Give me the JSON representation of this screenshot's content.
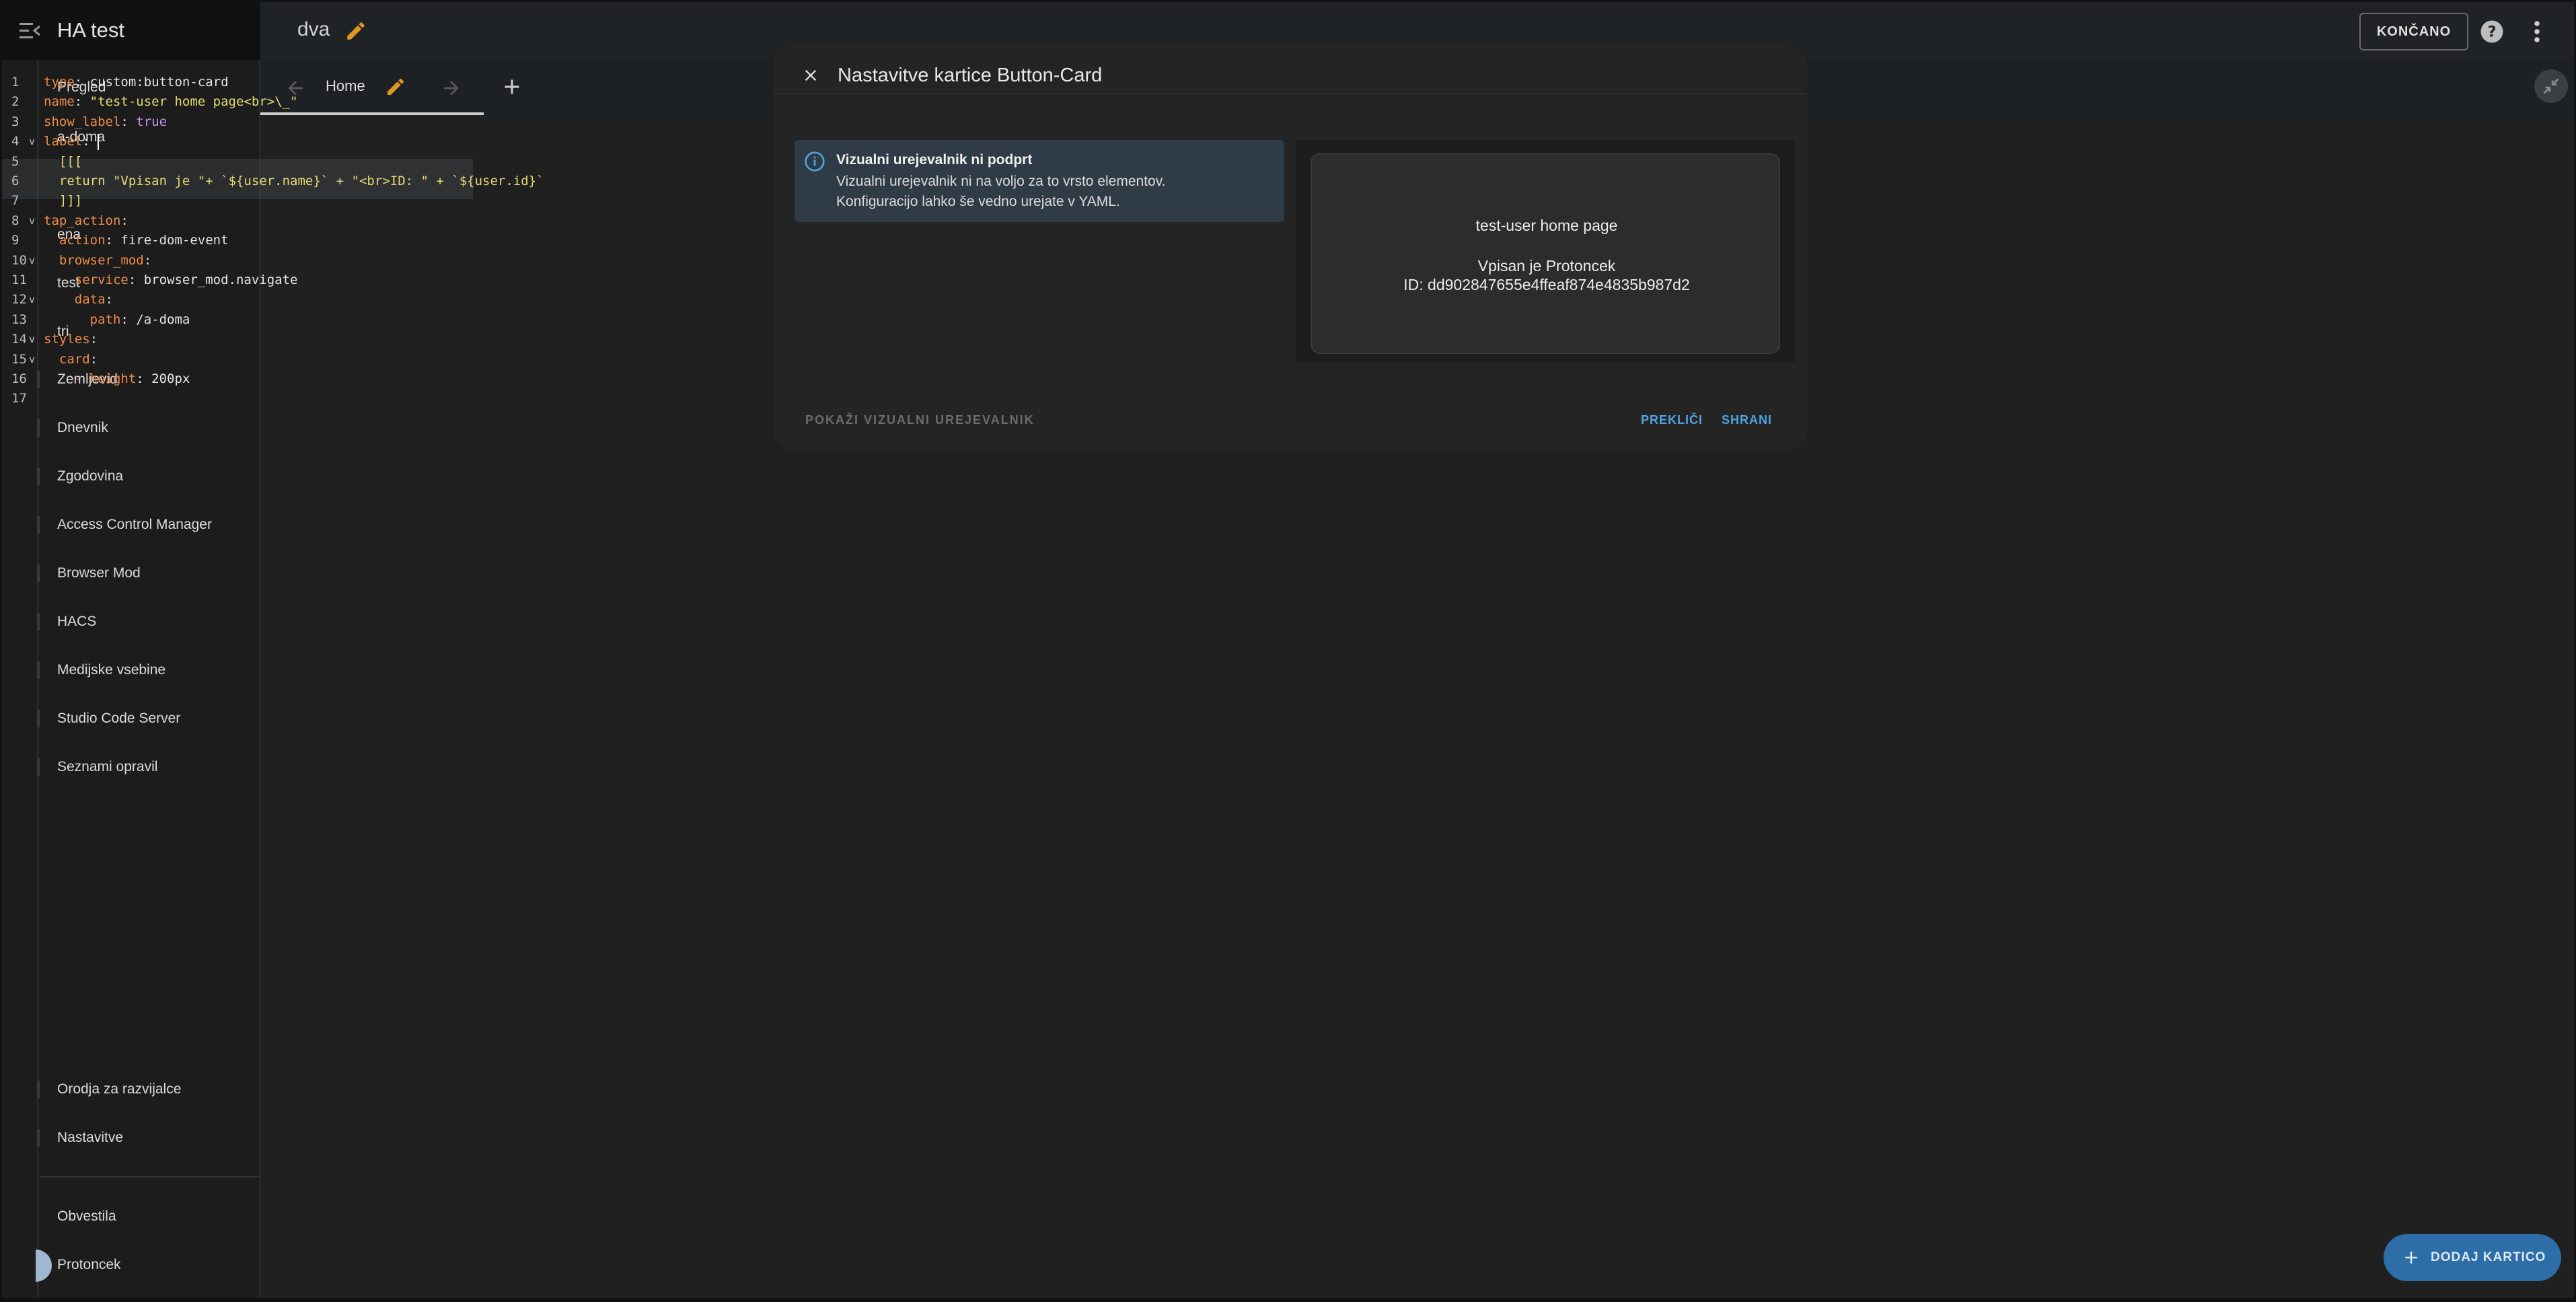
{
  "sidebar": {
    "title": "HA test",
    "items": [
      {
        "label": "Pregled"
      },
      {
        "label": "a-doma"
      },
      {
        "label": "ena"
      },
      {
        "label": "test"
      },
      {
        "label": "tri"
      },
      {
        "label": "Zemljevid"
      },
      {
        "label": "Dnevnik"
      },
      {
        "label": "Zgodovina"
      },
      {
        "label": "Access Control Manager"
      },
      {
        "label": "Browser Mod"
      },
      {
        "label": "HACS"
      },
      {
        "label": "Medijske vsebine"
      },
      {
        "label": "Studio Code Server"
      },
      {
        "label": "Seznami opravil"
      }
    ],
    "bottom_items": [
      {
        "label": "Orodja za razvijalce"
      },
      {
        "label": "Nastavitve"
      }
    ],
    "notifications_label": "Obvestila",
    "user_label": "Protoncek"
  },
  "topbar": {
    "view_title": "dva",
    "done_label": "KONČANO"
  },
  "tabbar": {
    "home_label": "Home"
  },
  "code": {
    "lines": [
      {
        "n": "1",
        "fold": "",
        "parts": [
          [
            "k",
            "type"
          ],
          [
            "p",
            ": custom:button-card"
          ]
        ]
      },
      {
        "n": "2",
        "fold": "",
        "parts": [
          [
            "k",
            "name"
          ],
          [
            "p",
            ": "
          ],
          [
            "s",
            "\"test-user home page<br>\\_\""
          ]
        ]
      },
      {
        "n": "3",
        "fold": "",
        "parts": [
          [
            "k",
            "show_label"
          ],
          [
            "p",
            ": "
          ],
          [
            "v",
            "true"
          ]
        ]
      },
      {
        "n": "4",
        "fold": "v",
        "parts": [
          [
            "k",
            "label"
          ],
          [
            "p",
            ": "
          ]
        ]
      },
      {
        "n": "5",
        "fold": "",
        "parts": [
          [
            "s",
            "  [[["
          ]
        ]
      },
      {
        "n": "6",
        "fold": "",
        "parts": [
          [
            "s",
            "  return \"Vpisan je \"+ `${user.name}` + \"<br>ID: \" + `${user.id}`"
          ]
        ]
      },
      {
        "n": "7",
        "fold": "",
        "parts": [
          [
            "s",
            "  ]]]"
          ]
        ]
      },
      {
        "n": "8",
        "fold": "v",
        "parts": [
          [
            "k",
            "tap_action"
          ],
          [
            "p",
            ":"
          ]
        ]
      },
      {
        "n": "9",
        "fold": "",
        "parts": [
          [
            "k",
            "  action"
          ],
          [
            "p",
            ": fire-dom-event"
          ]
        ]
      },
      {
        "n": "10",
        "fold": "v",
        "parts": [
          [
            "k",
            "  browser_mod"
          ],
          [
            "p",
            ":"
          ]
        ]
      },
      {
        "n": "11",
        "fold": "",
        "parts": [
          [
            "k",
            "    service"
          ],
          [
            "p",
            ": browser_mod.navigate"
          ]
        ]
      },
      {
        "n": "12",
        "fold": "v",
        "parts": [
          [
            "k",
            "    data"
          ],
          [
            "p",
            ":"
          ]
        ]
      },
      {
        "n": "13",
        "fold": "",
        "parts": [
          [
            "k",
            "      path"
          ],
          [
            "p",
            ": /a-doma"
          ]
        ]
      },
      {
        "n": "14",
        "fold": "v",
        "parts": [
          [
            "k",
            "styles"
          ],
          [
            "p",
            ":"
          ]
        ]
      },
      {
        "n": "15",
        "fold": "v",
        "parts": [
          [
            "k",
            "  card"
          ],
          [
            "p",
            ":"
          ]
        ]
      },
      {
        "n": "16",
        "fold": "",
        "parts": [
          [
            "k",
            "    - height"
          ],
          [
            "p",
            ": 200px"
          ]
        ]
      },
      {
        "n": "17",
        "fold": "",
        "parts": []
      }
    ]
  },
  "dialog": {
    "title": "Nastavitve kartice Button-Card",
    "alert_title": "Vizualni urejevalnik ni podprt",
    "alert_line1": "Vizualni urejevalnik ni na voljo za to vrsto elementov.",
    "alert_line2": "Konfiguracijo lahko še vedno urejate v YAML.",
    "preview_name": "test-user home page",
    "preview_line1": "Vpisan je Protoncek",
    "preview_line2": "ID: dd902847655e4ffeaf874e4835b987d2",
    "show_visual_label": "POKAŽI VIZUALNI UREJEVALNIK",
    "cancel_label": "PREKLIČI",
    "save_label": "SHRANI"
  },
  "fab": {
    "label": "DODAJ KARTICO"
  },
  "colors": {
    "accent": "#4fa3e0",
    "fab": "#2d6da8",
    "pencil": "#e0961f",
    "yaml_key": "#f08d49",
    "yaml_string": "#e6db74",
    "yaml_bool": "#c792ea"
  },
  "icons": {
    "menu": "menu-open-icon",
    "pencil": "pencil-icon",
    "help": "help-circle-icon",
    "more": "dots-vertical-icon",
    "close": "close-icon",
    "info": "information-outline-icon",
    "plus": "plus-icon",
    "back": "arrow-left-icon",
    "forward": "arrow-right-icon",
    "collapse": "arrow-collapse-icon"
  }
}
